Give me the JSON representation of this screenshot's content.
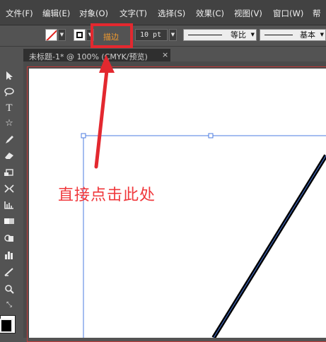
{
  "menu": {
    "items": [
      "文件(F)",
      "编辑(E)",
      "对象(O)",
      "文字(T)",
      "选择(S)",
      "效果(C)",
      "视图(V)",
      "窗口(W)",
      "帮"
    ]
  },
  "control_bar": {
    "fill_icon": "no-fill-swatch-icon",
    "stroke_icon": "stroke-swatch-icon",
    "stroke_label": "描边",
    "stroke_weight": "10 pt",
    "variable_width_profile": "等比",
    "brush_definition": "基本"
  },
  "document_tab": {
    "title": "未标题-1* @ 100% (CMYK/预览)",
    "close": "×"
  },
  "toolbar": {
    "tools": [
      {
        "icon": "selection-arrow-icon",
        "glyph": "▸"
      },
      {
        "icon": "lasso-icon",
        "glyph": "ℱ"
      },
      {
        "icon": "type-tool-icon",
        "glyph": "T"
      },
      {
        "icon": "star-tool-icon",
        "glyph": "☆"
      },
      {
        "icon": "pencil-icon",
        "glyph": "✎"
      },
      {
        "icon": "eraser-icon",
        "glyph": "▱"
      },
      {
        "icon": "rotate-icon",
        "glyph": "⟲"
      },
      {
        "icon": "width-tool-icon",
        "glyph": "⋈"
      },
      {
        "icon": "mesh-icon",
        "glyph": "▦"
      },
      {
        "icon": "gradient-icon",
        "glyph": "▭"
      },
      {
        "icon": "shape-builder-icon",
        "glyph": "◔"
      },
      {
        "icon": "column-graph-icon",
        "glyph": "▮"
      },
      {
        "icon": "slice-icon",
        "glyph": "⟋"
      },
      {
        "icon": "zoom-icon",
        "glyph": "⌕"
      }
    ],
    "swap_icon": "swap-colors-icon"
  },
  "annotation": {
    "text": "直接点击此处"
  },
  "colors": {
    "highlight": "#e3282f",
    "annotation": "#f0373b",
    "selection": "#4b7be0",
    "stroke_label": "#f29a2e"
  }
}
